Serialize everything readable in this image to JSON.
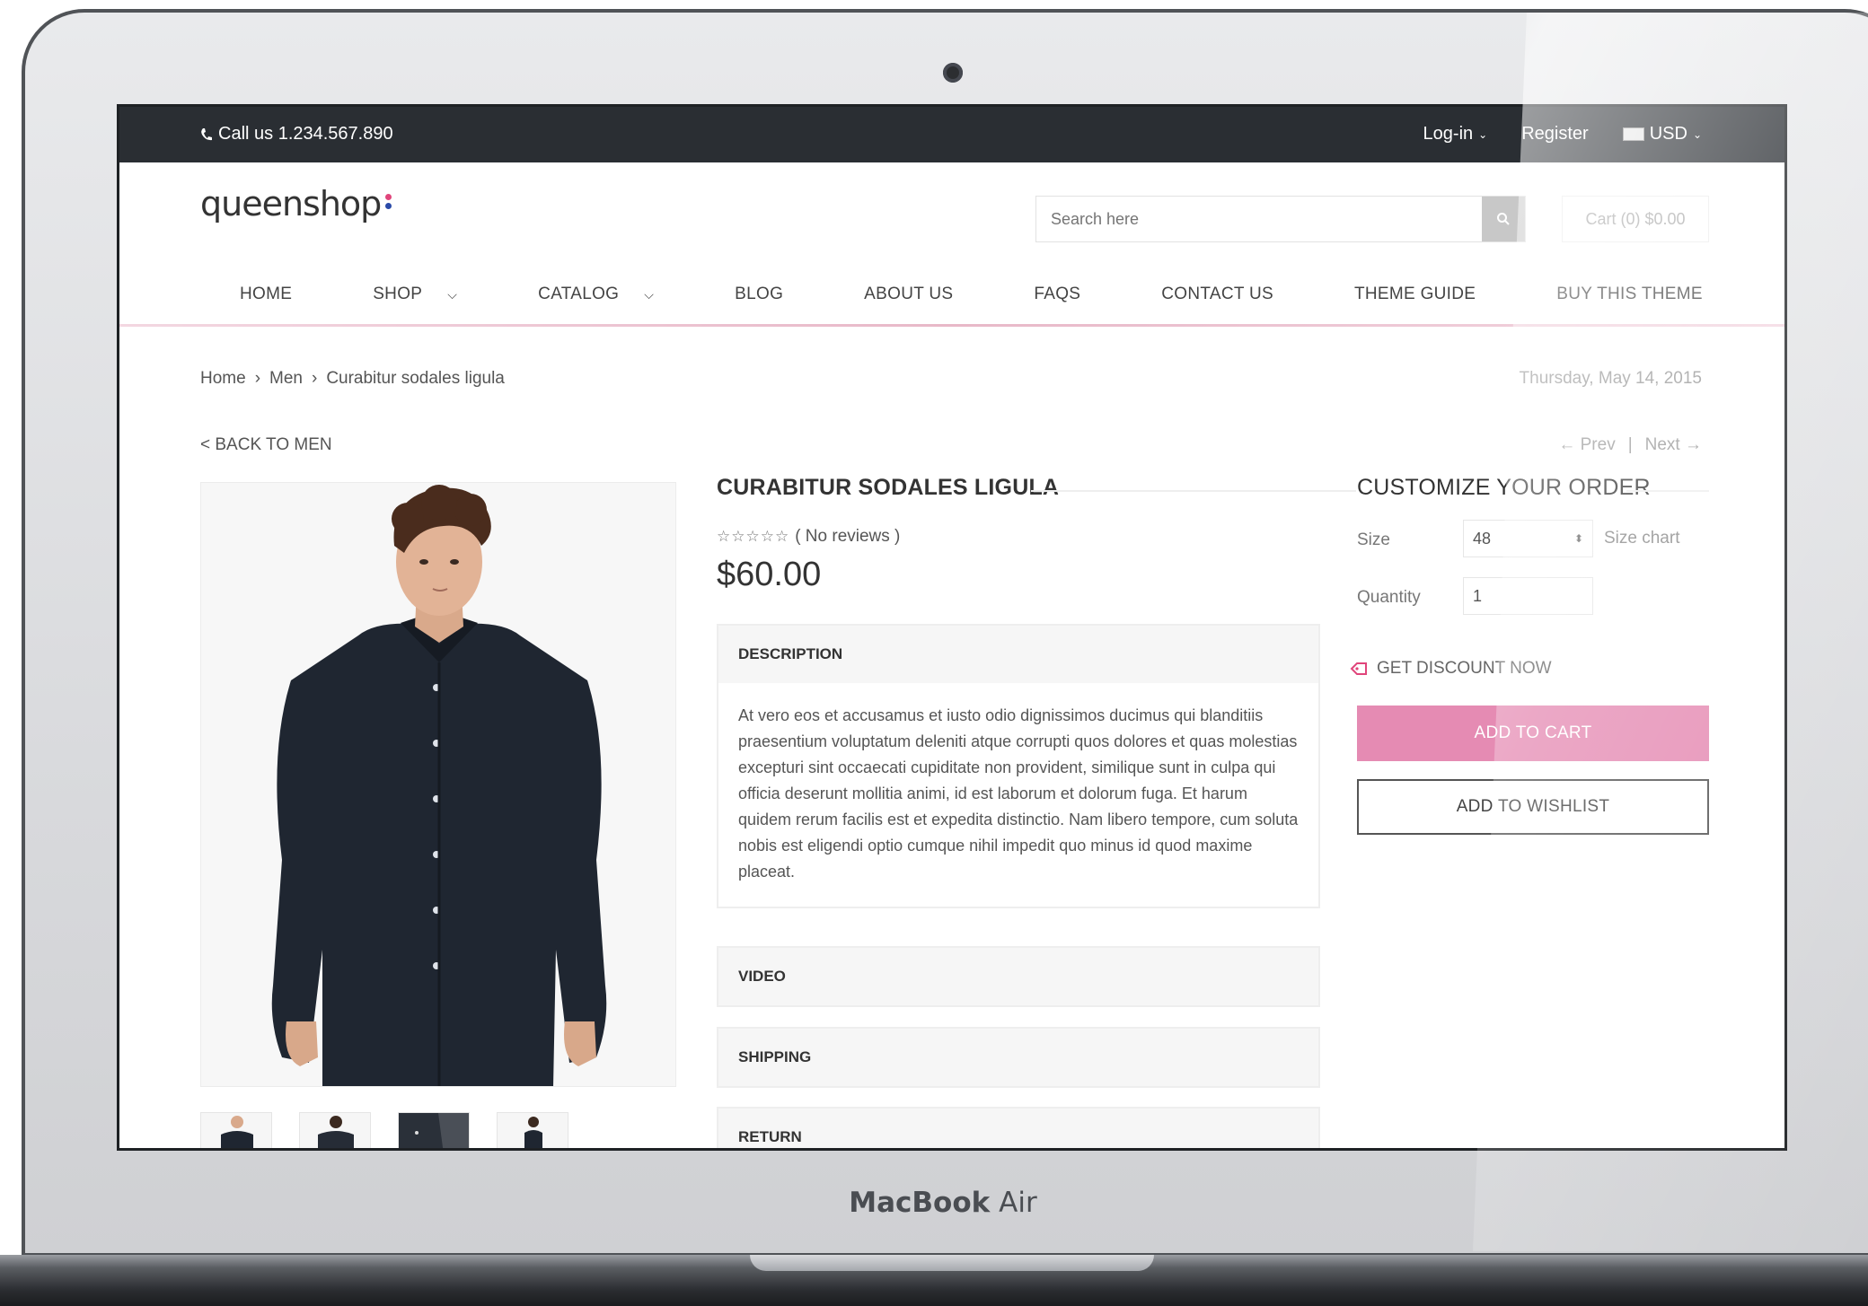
{
  "device": {
    "label_bold": "MacBook",
    "label_light": "Air"
  },
  "topbar": {
    "phone": "Call us 1.234.567.890",
    "login": "Log-in",
    "register": "Register",
    "currency": "USD"
  },
  "header": {
    "logo": "queenshop",
    "search_placeholder": "Search here",
    "cart": "Cart (0) $0.00"
  },
  "nav": {
    "items": [
      {
        "label": "HOME"
      },
      {
        "label": "SHOP"
      },
      {
        "label": "CATALOG"
      },
      {
        "label": "BLOG"
      },
      {
        "label": "ABOUT US"
      },
      {
        "label": "FAQS"
      },
      {
        "label": "CONTACT US"
      },
      {
        "label": "THEME GUIDE"
      },
      {
        "label": "BUY THIS THEME"
      }
    ]
  },
  "breadcrumb": {
    "items": [
      "Home",
      "Men",
      "Curabitur sodales ligula"
    ],
    "separator": "›"
  },
  "date": "Thursday, May 14, 2015",
  "back_link": "< BACK TO MEN",
  "pager": {
    "prev": "← Prev",
    "divider": "|",
    "next": "Next →"
  },
  "product": {
    "title": "CURABITUR SODALES LIGULA",
    "reviews": "( No reviews )",
    "price": "$60.00",
    "description_title": "DESCRIPTION",
    "description": "At vero eos et accusamus et iusto odio dignissimos ducimus qui blanditiis praesentium voluptatum deleniti atque corrupti quos dolores et quas molestias excepturi sint occaecati cupiditate non provident, similique sunt in culpa qui officia deserunt mollitia animi, id est laborum et dolorum fuga. Et harum quidem rerum facilis est et expedita distinctio. Nam libero tempore, cum soluta nobis est eligendi optio cumque nihil impedit quo minus id quod maxime placeat.",
    "tabs": [
      "VIDEO",
      "SHIPPING",
      "RETURN"
    ]
  },
  "customize": {
    "title": "CUSTOMIZE YOUR ORDER",
    "size_label": "Size",
    "size_value": "48",
    "size_chart": "Size chart",
    "quantity_label": "Quantity",
    "quantity_value": "1",
    "discount": "GET DISCOUNT NOW",
    "add_to_cart": "ADD TO CART",
    "add_to_wishlist": "ADD TO WISHLIST"
  },
  "colors": {
    "accent": "#e58bb3",
    "topbar": "#2a2e33"
  }
}
